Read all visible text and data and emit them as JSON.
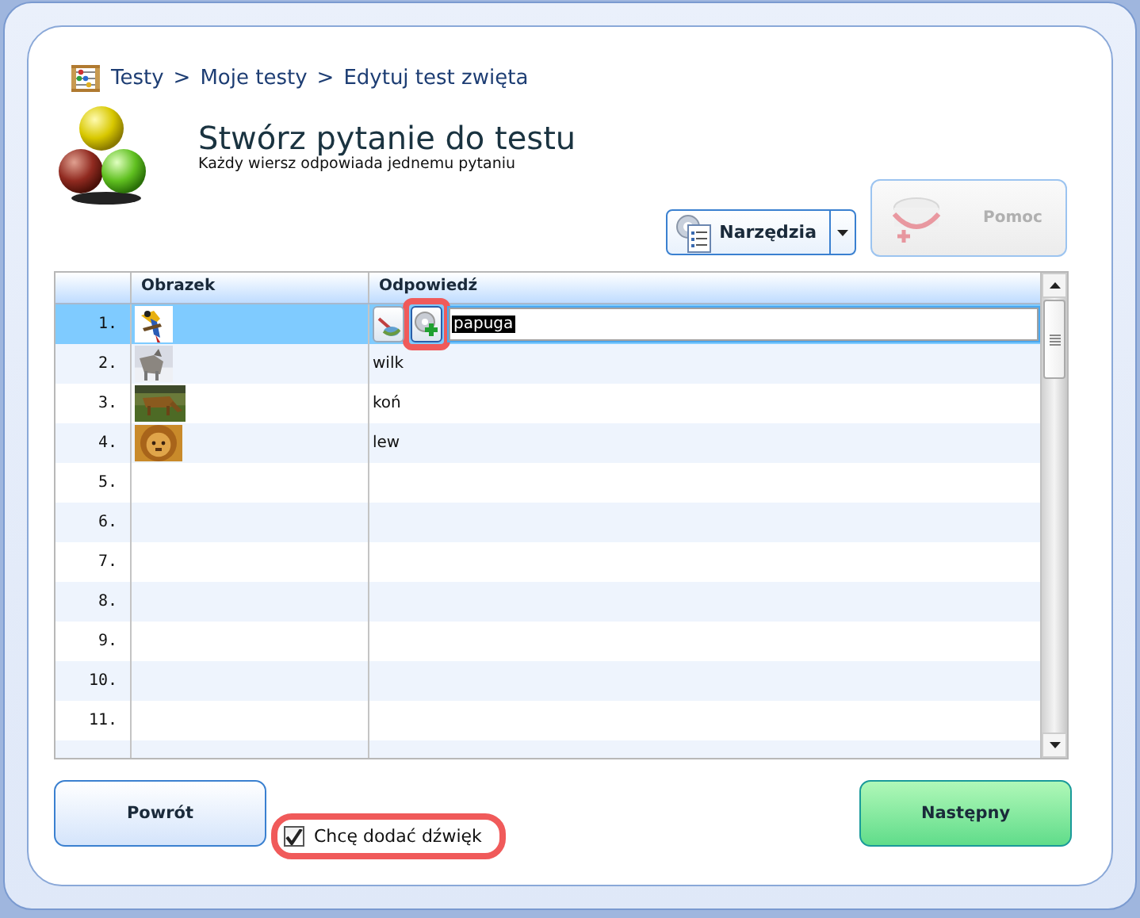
{
  "breadcrumb": {
    "separator": ">",
    "items": [
      "Testy",
      "Moje testy",
      "Edytuj test zwięta"
    ]
  },
  "header": {
    "title": "Stwórz pytanie do testu",
    "subtitle": "Każdy wiersz odpowiada jednemu pytaniu"
  },
  "tools_button": {
    "label": "Narzędzia"
  },
  "help_button": {
    "label": "Pomoc",
    "disabled": true
  },
  "table": {
    "columns": [
      "Obrazek",
      "Odpowiedź"
    ],
    "rows": [
      {
        "number": "1.",
        "answer": "papuga",
        "selected": true,
        "editing": true,
        "sound_button_highlighted": true
      },
      {
        "number": "2.",
        "answer": "wilk",
        "selected": false
      },
      {
        "number": "3.",
        "answer": "koń",
        "selected": false
      },
      {
        "number": "4.",
        "answer": "lew",
        "selected": false
      },
      {
        "number": "5.",
        "selected": false
      },
      {
        "number": "6.",
        "selected": false
      },
      {
        "number": "7.",
        "selected": false
      },
      {
        "number": "8.",
        "selected": false
      },
      {
        "number": "9.",
        "selected": false
      },
      {
        "number": "10.",
        "selected": false
      },
      {
        "number": "11.",
        "selected": false
      }
    ]
  },
  "back_button": {
    "label": "Powrót"
  },
  "sound_checkbox": {
    "label": "Chcę dodać dźwięk",
    "checked": true,
    "highlighted": true
  },
  "next_button": {
    "label": "Następny"
  }
}
